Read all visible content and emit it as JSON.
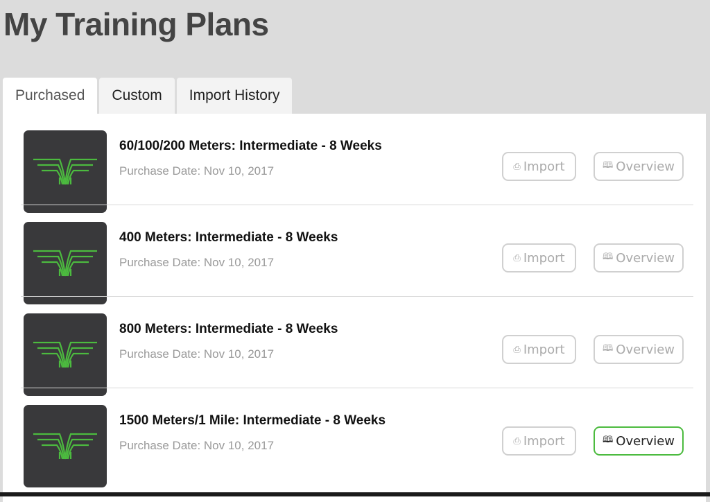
{
  "page": {
    "title": "My Training Plans"
  },
  "tabs": [
    {
      "label": "Purchased",
      "active": true
    },
    {
      "label": "Custom",
      "active": false
    },
    {
      "label": "Import History",
      "active": false
    }
  ],
  "colors": {
    "accent": "#4cbb3f",
    "thumb_bg": "#39393b",
    "logo": "#4cbb3f"
  },
  "icons": {
    "import": "export-icon",
    "overview": "book-icon",
    "logo": "wings-logo-icon"
  },
  "buttons": {
    "import_label": "Import",
    "overview_label": "Overview",
    "import_icon": "⎙",
    "overview_icon": "🕮"
  },
  "plans": [
    {
      "title": "60/100/200 Meters: Intermediate - 8 Weeks",
      "date": "Purchase Date: Nov 10, 2017"
    },
    {
      "title": "400 Meters: Intermediate - 8 Weeks",
      "date": "Purchase Date: Nov 10, 2017"
    },
    {
      "title": "800 Meters: Intermediate - 8 Weeks",
      "date": "Purchase Date: Nov 10, 2017"
    },
    {
      "title": "1500 Meters/1 Mile: Intermediate - 8 Weeks",
      "date": "Purchase Date: Nov 10, 2017"
    }
  ]
}
